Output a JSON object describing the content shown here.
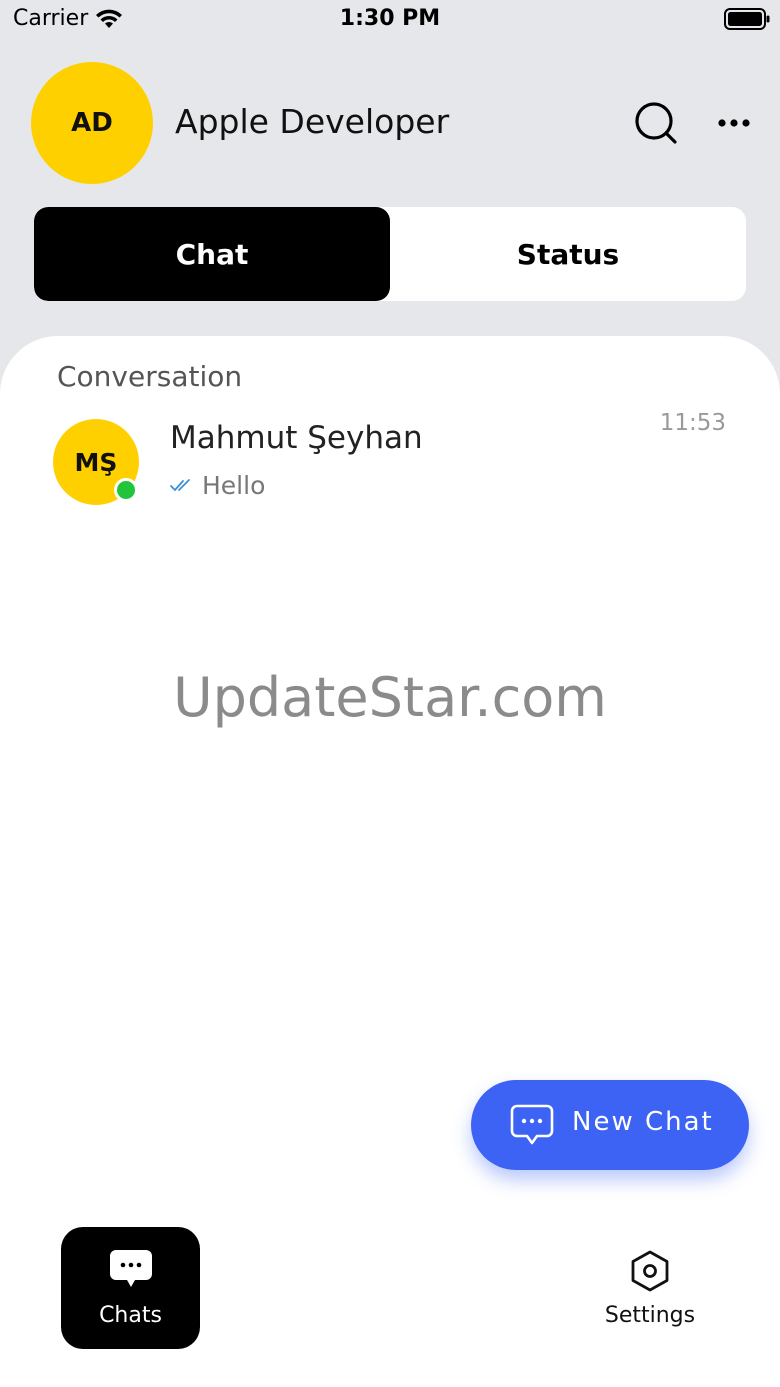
{
  "status_bar": {
    "carrier": "Carrier",
    "time": "1:30 PM",
    "wifi_icon": "wifi-icon",
    "battery_icon": "battery-icon"
  },
  "header": {
    "avatar_initials": "AD",
    "avatar_color": "#ffd000",
    "name": "Apple Developer",
    "search_icon": "search-icon",
    "more_icon": "more-icon"
  },
  "tabs": [
    {
      "label": "Chat",
      "active": true
    },
    {
      "label": "Status",
      "active": false
    }
  ],
  "conversations": {
    "section_title": "Conversation",
    "items": [
      {
        "initials": "MŞ",
        "name": "Mahmut Şeyhan",
        "last_message": "Hello",
        "time": "11:53",
        "online": true,
        "online_color": "#22c53a",
        "read_icon": "double-check-icon"
      }
    ]
  },
  "watermark": "UpdateStar.com",
  "fab": {
    "label": "New Chat",
    "icon": "chat-bubble-icon",
    "color": "#3d63f5"
  },
  "bottom_nav": {
    "items": [
      {
        "label": "Chats",
        "icon": "chat-bubble-icon",
        "active": true
      },
      {
        "label": "Settings",
        "icon": "settings-hexagon-icon",
        "active": false
      }
    ]
  }
}
